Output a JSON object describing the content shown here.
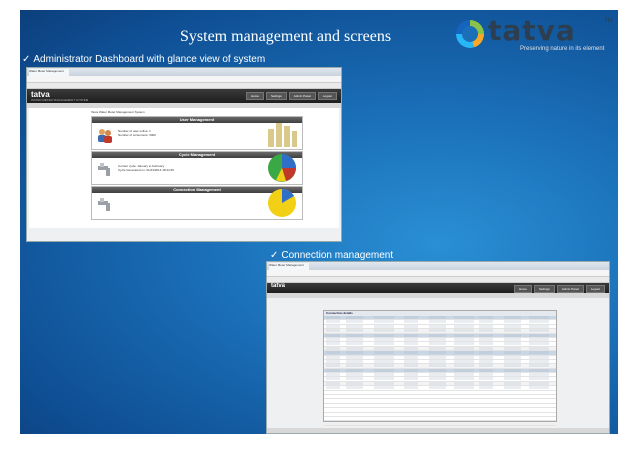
{
  "slide": {
    "title": "System management and screens",
    "logo": {
      "word": "tatva",
      "tm": "TM",
      "tagline": "Preserving nature in its element"
    },
    "bullets": [
      {
        "check": "✓",
        "text": "Administrator Dashboard with glance view of system"
      },
      {
        "check": "✓",
        "text": "Connection management"
      }
    ]
  },
  "dashboard": {
    "tab": "Water Meter Management",
    "app_logo": "tatva",
    "app_subtitle": "WATER METER MANAGEMENT SYSTEM",
    "header_buttons": [
      "Home",
      "Settings",
      "Admin Panel",
      "Logout"
    ],
    "welcome": "Tatva Water Meter Management System",
    "panels": [
      {
        "title": "User Management",
        "lines": [
          "Number of user online: 1",
          "Number of consumers: 3000"
        ],
        "chart": "bar"
      },
      {
        "title": "Cycle Management",
        "lines": [
          "Current cycle: January to February",
          "Cycle Generated on: 01/23/2014 18:44:35"
        ],
        "chart": "pie"
      },
      {
        "title": "Connection Management",
        "lines": [],
        "chart": "pie-partial"
      }
    ],
    "colors": {
      "panel_head": "#4a4a4a",
      "bar": "#d9c98a",
      "pie_green": "#3aa845",
      "pie_blue": "#2f6fc7",
      "pie_yellow": "#f1d016"
    }
  },
  "connections": {
    "tab": "Water Meter Management",
    "header_buttons": [
      "Home",
      "Settings",
      "Admin Panel",
      "Logout"
    ],
    "grid_title": "Connection details"
  }
}
